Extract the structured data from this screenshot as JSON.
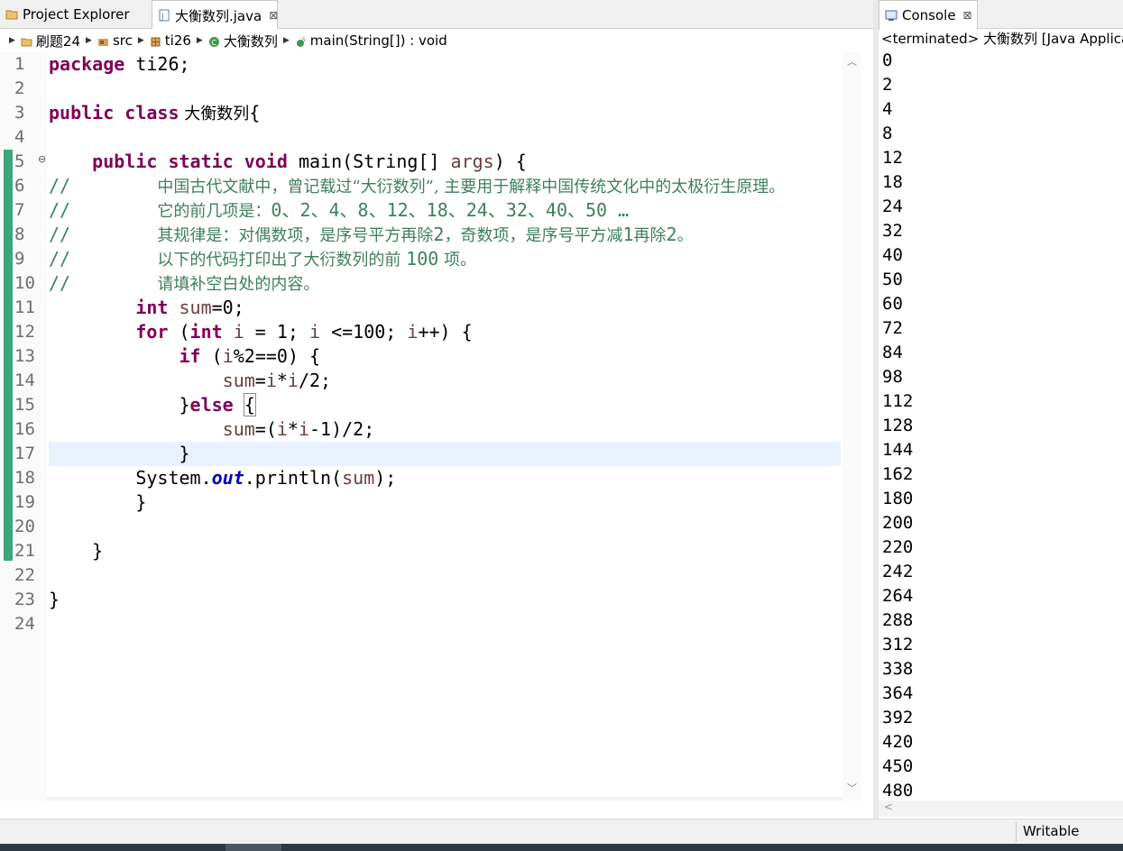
{
  "tabs": {
    "project_explorer": "Project Explorer",
    "editor_file": "大衡数列.java",
    "console": "Console"
  },
  "breadcrumb": [
    "刷题24",
    "src",
    "ti26",
    "大衡数列",
    "main(String[]) : void"
  ],
  "editor": {
    "line_numbers": [
      "1",
      "2",
      "3",
      "4",
      "5",
      "6",
      "7",
      "8",
      "9",
      "10",
      "11",
      "12",
      "13",
      "14",
      "15",
      "16",
      "17",
      "18",
      "19",
      "20",
      "21",
      "22",
      "23",
      "24"
    ],
    "code": {
      "l1_kw": "package",
      "l1_rest": " ti26;",
      "l3_kw1": "public",
      "l3_kw2": "class",
      "l3_name": " 大衡数列",
      "l3_rest": "{",
      "l5_kw": "public static void",
      "l5_a": " main(String[] ",
      "l5_var": "args",
      "l5_b": ") {",
      "l6_c": "//",
      "l6_t": "中国古代文献中，曾记载过“大衍数列”, 主要用于解释中国传统文化中的太极衍生原理。",
      "l7_c": "//",
      "l7_t": "它的前几项是：",
      "l7_n": "0、2、4、8、12、18、24、32、40、50 …",
      "l8_c": "//",
      "l8_t": "其规律是：对偶数项，是序号平方再除",
      "l8_n1": "2",
      "l8_t2": "，奇数项，是序号平方减",
      "l8_n2": "1",
      "l8_t3": "再除",
      "l8_n3": "2",
      "l8_t4": "。",
      "l9_c": "//",
      "l9_t": "以下的代码打印出了大衍数列的前 ",
      "l9_n": "100",
      "l9_t2": " 项。",
      "l10_c": "//",
      "l10_t": "请填补空白处的内容。",
      "l11_kw": "int",
      "l11_var": " sum",
      "l11_rest": "=0;",
      "l12_kw": "for",
      "l12_a": " (",
      "l12_kw2": "int",
      "l12_v1": " i",
      "l12_b": " = 1; ",
      "l12_v2": "i",
      "l12_c": " <=100; ",
      "l12_v3": "i",
      "l12_d": "++) {",
      "l13_kw": "if",
      "l13_a": " (",
      "l13_v": "i",
      "l13_b": "%2==0) {",
      "l14_v1": "sum",
      "l14_a": "=",
      "l14_v2": "i",
      "l14_b": "*",
      "l14_v3": "i",
      "l14_c": "/2;",
      "l15_a": "}",
      "l15_kw": "else",
      "l15_b": " ",
      "l15_br": "{",
      "l16_v1": "sum",
      "l16_a": "=(",
      "l16_v2": "i",
      "l16_b": "*",
      "l16_v3": "i",
      "l16_c": "-1)/2;",
      "l17": "}",
      "l18_a": "System.",
      "l18_f": "out",
      "l18_b": ".println(",
      "l18_v": "sum",
      "l18_c": ");",
      "l19": "}",
      "l21": "}",
      "l23": "}"
    }
  },
  "console": {
    "header": "<terminated> 大衡数列 [Java Applicat",
    "output": [
      "0",
      "2",
      "4",
      "8",
      "12",
      "18",
      "24",
      "32",
      "40",
      "50",
      "60",
      "72",
      "84",
      "98",
      "112",
      "128",
      "144",
      "162",
      "180",
      "200",
      "220",
      "242",
      "264",
      "288",
      "312",
      "338",
      "364",
      "392",
      "420",
      "450",
      "480"
    ]
  },
  "status": {
    "writable": "Writable"
  },
  "colors": {
    "keyword": "#7f0055",
    "comment": "#3f7f5f",
    "local_var": "#6a3e3e",
    "field": "#0000c0",
    "current_line": "#e8f2fe"
  }
}
